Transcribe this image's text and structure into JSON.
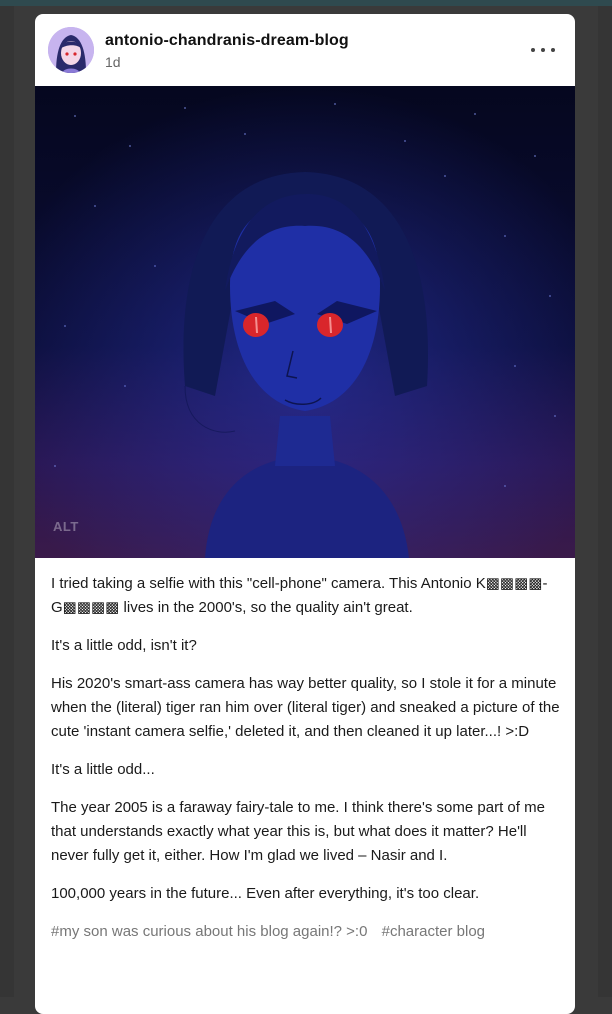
{
  "post": {
    "blog_name": "antonio-chandranis-dream-blog",
    "time_ago": "1d",
    "more_icon": "more-horizontal-icon",
    "image_alt_badge": "ALT",
    "paragraphs": [
      "I tried taking a selfie with this \"cell-phone\" camera. This Antonio K▩▩▩▩-G▩▩▩▩ lives in the 2000's, so the quality ain't great.",
      "It's a little odd, isn't it?",
      "His 2020's smart-ass camera has way better quality, so I stole it for a minute when the (literal) tiger ran him over (literal tiger) and sneaked a picture of the cute 'instant camera selfie,' deleted it, and then cleaned it up later...! >:D",
      "It's a little odd...",
      "The year 2005 is a faraway fairy-tale to me. I think there's some part of me that understands exactly what year this is, but what does it matter? He'll never fully get it, either. How I'm glad we lived – Nasir and I.",
      "100,000 years in the future... Even after everything, it's too clear."
    ],
    "tags": [
      "#my son was curious about his blog again!? >:0",
      "#character blog"
    ]
  },
  "colors": {
    "page_background": "#3a3a3a",
    "card_background": "#ffffff",
    "eye_color": "#d9262b",
    "night_sky": "#0a0b2a"
  }
}
